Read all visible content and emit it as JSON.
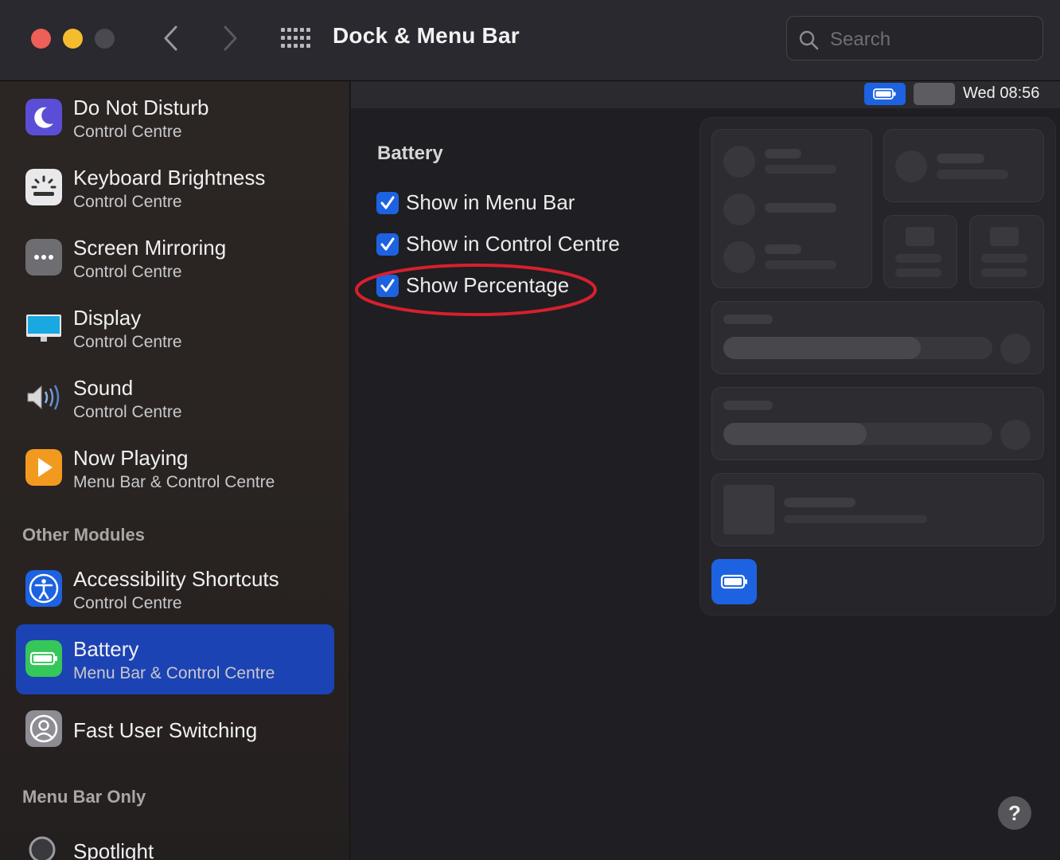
{
  "window": {
    "title": "Dock & Menu Bar",
    "search_placeholder": "Search"
  },
  "sidebar": {
    "items": [
      {
        "label": "Do Not Disturb",
        "sub": "Control Centre",
        "icon": "moon-icon"
      },
      {
        "label": "Keyboard Brightness",
        "sub": "Control Centre",
        "icon": "keyboard-brightness-icon"
      },
      {
        "label": "Screen Mirroring",
        "sub": "Control Centre",
        "icon": "screen-mirroring-icon"
      },
      {
        "label": "Display",
        "sub": "Control Centre",
        "icon": "display-icon"
      },
      {
        "label": "Sound",
        "sub": "Control Centre",
        "icon": "speaker-icon"
      },
      {
        "label": "Now Playing",
        "sub": "Menu Bar & Control Centre",
        "icon": "play-icon"
      }
    ],
    "other_modules_header": "Other Modules",
    "other_items": [
      {
        "label": "Accessibility Shortcuts",
        "sub": "Control Centre",
        "icon": "accessibility-icon"
      },
      {
        "label": "Battery",
        "sub": "Menu Bar & Control Centre",
        "icon": "battery-icon",
        "selected": true
      },
      {
        "label": "Fast User Switching",
        "icon": "user-icon"
      }
    ],
    "menu_bar_only_header": "Menu Bar Only",
    "menu_bar_only_items": [
      {
        "label": "Spotlight",
        "icon": "spotlight-icon"
      }
    ]
  },
  "menubar_preview": {
    "clock": "Wed 08:56"
  },
  "battery_settings": {
    "title": "Battery",
    "options": [
      {
        "label": "Show in Menu Bar",
        "checked": true
      },
      {
        "label": "Show in Control Centre",
        "checked": true
      },
      {
        "label": "Show Percentage",
        "checked": true
      }
    ]
  },
  "colors": {
    "accent": "#1d62e0",
    "selected_row": "#1c43b3",
    "annotation": "#d6202e"
  },
  "help_label": "?"
}
